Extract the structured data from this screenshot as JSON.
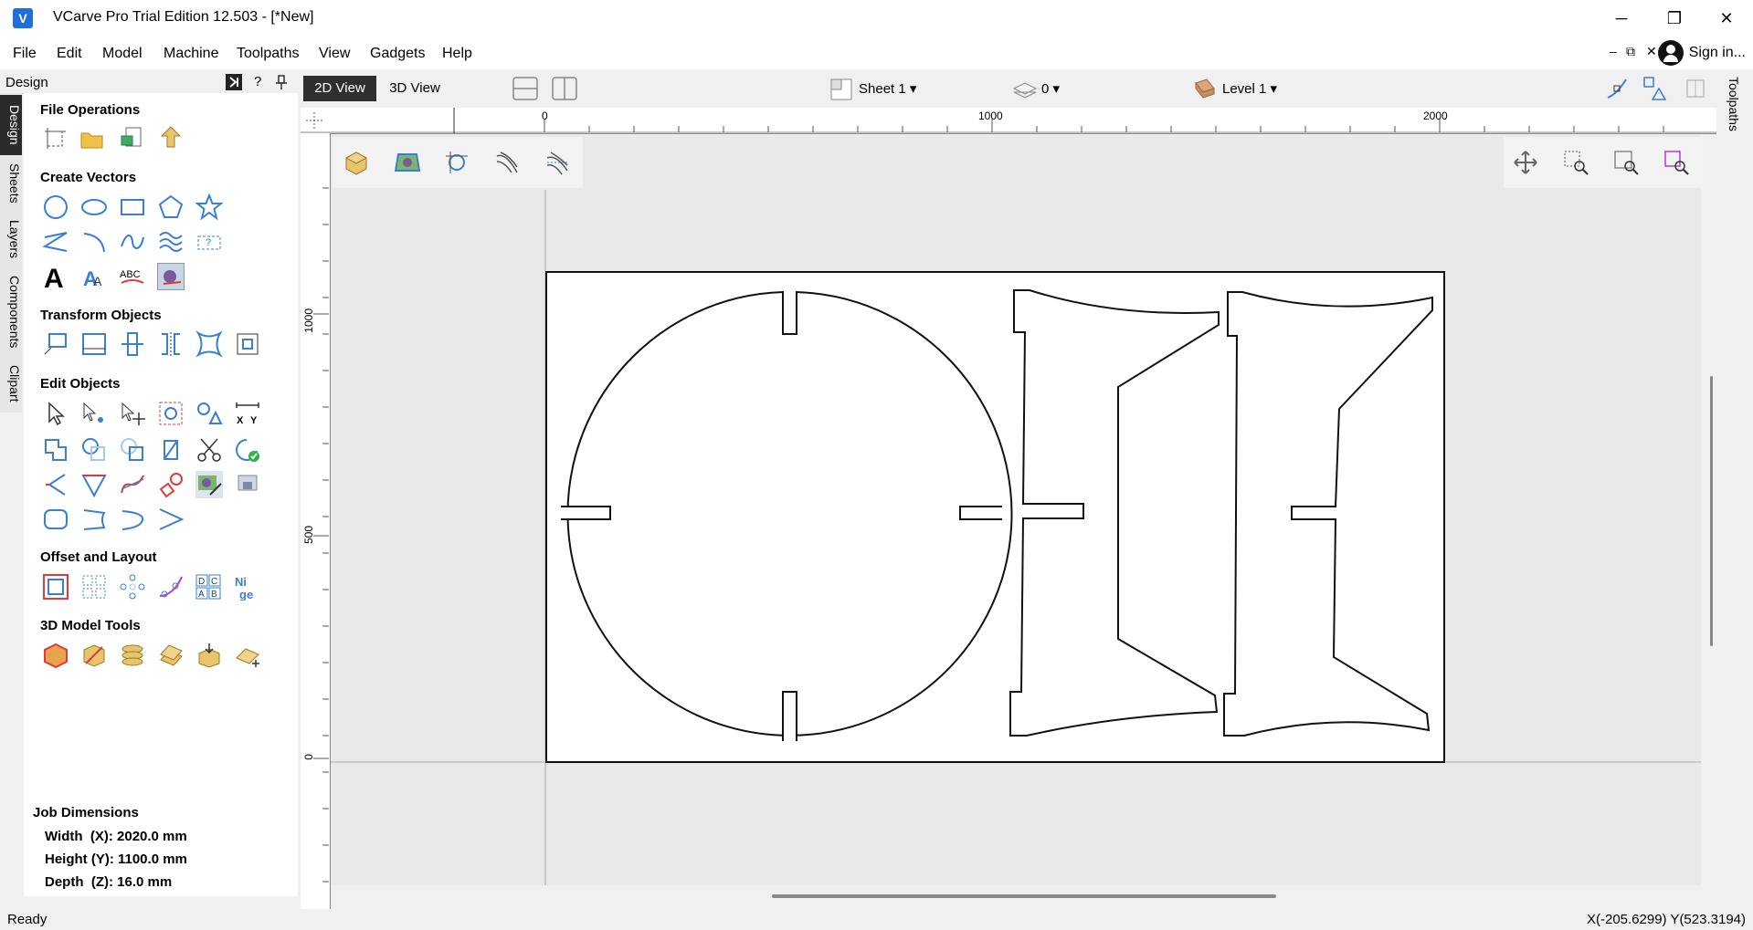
{
  "window": {
    "title": "VCarve Pro Trial Edition 12.503 - [*New]",
    "minimize": "─",
    "restore": "❐",
    "close": "✕"
  },
  "menu": [
    "File",
    "Edit",
    "Model",
    "Machine",
    "Toolpaths",
    "View",
    "Gadgets",
    "Help"
  ],
  "account": {
    "sign_in": "Sign in..."
  },
  "mdi": {
    "minimize": "–",
    "restore": "⧉",
    "close": "✕"
  },
  "design_panel": {
    "title": "Design",
    "help": "?",
    "vertical_tabs": [
      "Design",
      "Sheets",
      "Layers",
      "Components",
      "Clipart"
    ]
  },
  "sections": {
    "file_operations": "File Operations",
    "create_vectors": "Create Vectors",
    "transform_objects": "Transform Objects",
    "edit_objects": "Edit Objects",
    "offset_layout": "Offset and Layout",
    "model_tools": "3D Model Tools"
  },
  "job": {
    "title": "Job Dimensions",
    "width": "Width  (X): 2020.0 mm",
    "height": "Height (Y): 1100.0 mm",
    "depth": "Depth  (Z): 16.0 mm"
  },
  "view": {
    "tab_2d": "2D View",
    "tab_3d": "3D View",
    "sheet": "Sheet 1 ▾",
    "layer_count": "0 ▾",
    "level": "Level 1 ▾"
  },
  "rulers": {
    "top_ticks": [
      "0",
      "1000",
      "2000"
    ],
    "left_ticks": [
      "1000",
      "500",
      "0"
    ]
  },
  "right_panel": {
    "label": "Toolpaths"
  },
  "status": {
    "left": "Ready",
    "coords": "X(-205.6299) Y(523.3194)"
  },
  "icons": {
    "app": "vcarve-logo-icon",
    "colors": {
      "vector_blue": "#3a7fd6",
      "red_select": "#e03a3a",
      "wood": "#e8c46a"
    }
  }
}
